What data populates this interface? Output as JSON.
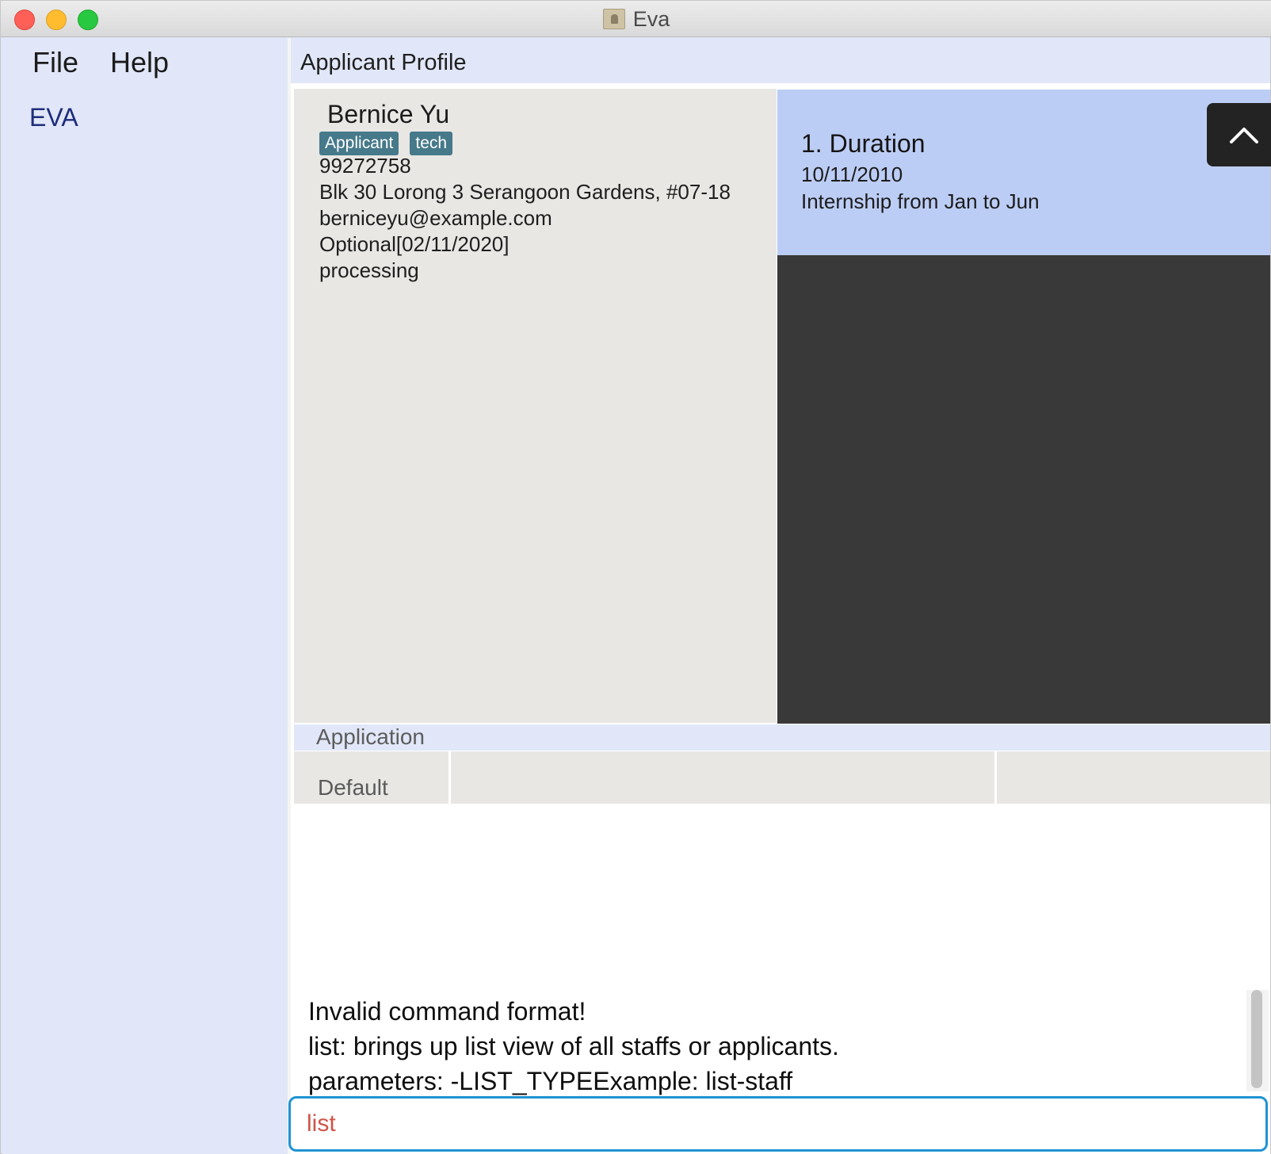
{
  "window": {
    "title": "Eva"
  },
  "menu": {
    "file": "File",
    "help": "Help"
  },
  "sidebar": {
    "brand": "EVA"
  },
  "main": {
    "header": "Applicant Profile"
  },
  "profile": {
    "name": "Bernice Yu",
    "tags": [
      "Applicant",
      "tech"
    ],
    "phone": "99272758",
    "address": "Blk 30 Lorong 3 Serangoon Gardens, #07-18",
    "email": "berniceyu@example.com",
    "interview": "Optional[02/11/2020]",
    "status": "processing"
  },
  "experience": [
    {
      "title": "1.  Duration",
      "date": "10/11/2010",
      "description": "Internship from Jan to Jun"
    }
  ],
  "application": {
    "header": "Application",
    "tab": "Default"
  },
  "result": {
    "lines": [
      "Invalid command format!",
      "list: brings up list view of all staffs or applicants.",
      "parameters: -LIST_TYPEExample: list-staff"
    ]
  },
  "command": {
    "value": "list"
  },
  "colors": {
    "accent": "#1f94d2",
    "tag": "#46798a",
    "error_text": "#cf5449",
    "card_highlight": "#bccdf5"
  },
  "icons": {
    "scroll_top": "chevron-up-icon",
    "window_icon": "contact-card-icon"
  }
}
